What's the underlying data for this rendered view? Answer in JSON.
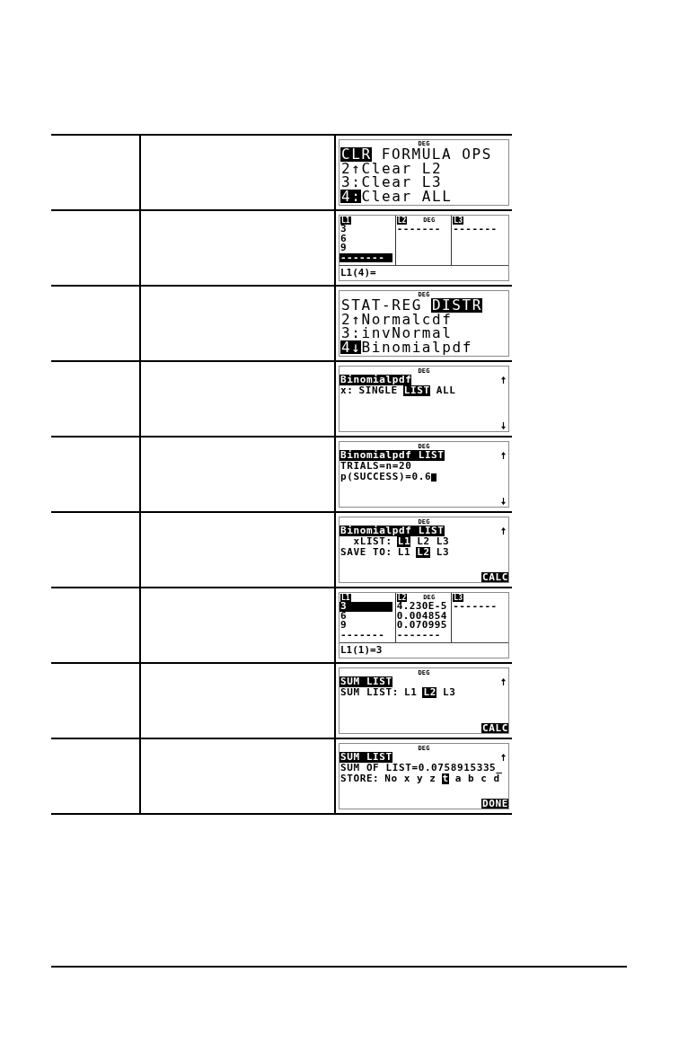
{
  "table": {
    "rows": [
      {
        "screen": {
          "kind": "menu",
          "status": "DEG",
          "tabs": [
            {
              "label": "CLR",
              "selected": true
            },
            {
              "label": "FORMULA",
              "selected": false
            },
            {
              "label": "OPS",
              "selected": false
            }
          ],
          "items": [
            {
              "key": "2↑",
              "label": "Clear L2",
              "selected": false
            },
            {
              "key": "3:",
              "label": "Clear L3",
              "selected": false
            },
            {
              "key": "4:",
              "label": "Clear ALL",
              "selected": true
            }
          ]
        }
      },
      {
        "screen": {
          "kind": "list_editor",
          "status": "DEG",
          "columns": [
            {
              "header": "L1",
              "cells": [
                {
                  "value": "3",
                  "selected": false
                },
                {
                  "value": "6",
                  "selected": false
                },
                {
                  "value": "9",
                  "selected": false
                },
                {
                  "value": "-------",
                  "selected": true
                }
              ]
            },
            {
              "header": "L2",
              "cells": [
                {
                  "value": "-------",
                  "selected": false
                }
              ]
            },
            {
              "header": "L3",
              "cells": [
                {
                  "value": "-------",
                  "selected": false
                }
              ]
            }
          ],
          "entry": "L1(4)="
        }
      },
      {
        "screen": {
          "kind": "menu",
          "status": "DEG",
          "tabs": [
            {
              "label": "STAT-REG",
              "selected": false
            },
            {
              "label": "DISTR",
              "selected": true
            }
          ],
          "items": [
            {
              "key": "2↑",
              "label": "Normalcdf",
              "selected": false
            },
            {
              "key": "3:",
              "label": "invNormal",
              "selected": false
            },
            {
              "key": "4↓",
              "label": "Binomialpdf",
              "selected": true
            }
          ]
        }
      },
      {
        "screen": {
          "kind": "form",
          "status": "DEG",
          "title": "Binomialpdf",
          "scroll_up": true,
          "scroll_down": true,
          "lines": [
            {
              "kind": "options",
              "label": "x:",
              "options": [
                {
                  "label": "SINGLE",
                  "selected": false
                },
                {
                  "label": "LIST",
                  "selected": true
                },
                {
                  "label": "ALL",
                  "selected": false
                }
              ]
            }
          ]
        }
      },
      {
        "screen": {
          "kind": "form",
          "status": "DEG",
          "title": "Binomialpdf LIST",
          "scroll_up": true,
          "scroll_down": true,
          "lines": [
            {
              "kind": "text",
              "text": "TRIALS=n=20",
              "cursor": false
            },
            {
              "kind": "text",
              "text": "p(SUCCESS)=0.6",
              "cursor": true
            }
          ]
        }
      },
      {
        "screen": {
          "kind": "form",
          "status": "DEG",
          "title": "Binomialpdf LIST",
          "scroll_up": true,
          "lines": [
            {
              "kind": "options",
              "label": "xLIST:",
              "options": [
                {
                  "label": "L1",
                  "selected": true
                },
                {
                  "label": "L2",
                  "selected": false
                },
                {
                  "label": "L3",
                  "selected": false
                }
              ]
            },
            {
              "kind": "options",
              "label": "SAVE TO:",
              "options": [
                {
                  "label": "L1",
                  "selected": false
                },
                {
                  "label": "L2",
                  "selected": true
                },
                {
                  "label": "L3",
                  "selected": false
                }
              ]
            }
          ],
          "softkey": "CALC"
        }
      },
      {
        "screen": {
          "kind": "list_editor",
          "status": "DEG",
          "columns": [
            {
              "header": "L1",
              "cells": [
                {
                  "value": "3",
                  "selected": true
                },
                {
                  "value": "6",
                  "selected": false
                },
                {
                  "value": "9",
                  "selected": false
                },
                {
                  "value": "-------",
                  "selected": false
                }
              ]
            },
            {
              "header": "L2",
              "cells": [
                {
                  "value": "4.230E-5",
                  "selected": false
                },
                {
                  "value": "0.004854",
                  "selected": false
                },
                {
                  "value": "0.070995",
                  "selected": false
                },
                {
                  "value": "-------",
                  "selected": false
                }
              ]
            },
            {
              "header": "L3",
              "cells": [
                {
                  "value": "-------",
                  "selected": false
                }
              ]
            }
          ],
          "entry": "L1(1)=3"
        }
      },
      {
        "screen": {
          "kind": "form",
          "status": "DEG",
          "title": "SUM LIST",
          "scroll_up": true,
          "lines": [
            {
              "kind": "options",
              "label": "SUM LIST:",
              "options": [
                {
                  "label": "L1",
                  "selected": false
                },
                {
                  "label": "L2",
                  "selected": true
                },
                {
                  "label": "L3",
                  "selected": false
                }
              ]
            }
          ],
          "softkey": "CALC"
        }
      },
      {
        "screen": {
          "kind": "form",
          "status": "DEG",
          "title": "SUM LIST",
          "scroll_up": true,
          "lines": [
            {
              "kind": "text",
              "text": "SUM OF LIST=0.0758915335_",
              "cursor": false
            },
            {
              "kind": "options",
              "label": "STORE:",
              "options": [
                {
                  "label": "No",
                  "selected": false
                },
                {
                  "label": "x",
                  "selected": false
                },
                {
                  "label": "y",
                  "selected": false
                },
                {
                  "label": "z",
                  "selected": false
                },
                {
                  "label": "t",
                  "selected": true
                },
                {
                  "label": "a",
                  "selected": false
                },
                {
                  "label": "b",
                  "selected": false
                },
                {
                  "label": "c",
                  "selected": false
                },
                {
                  "label": "d",
                  "selected": false
                }
              ]
            }
          ],
          "softkey": "DONE"
        }
      }
    ]
  }
}
